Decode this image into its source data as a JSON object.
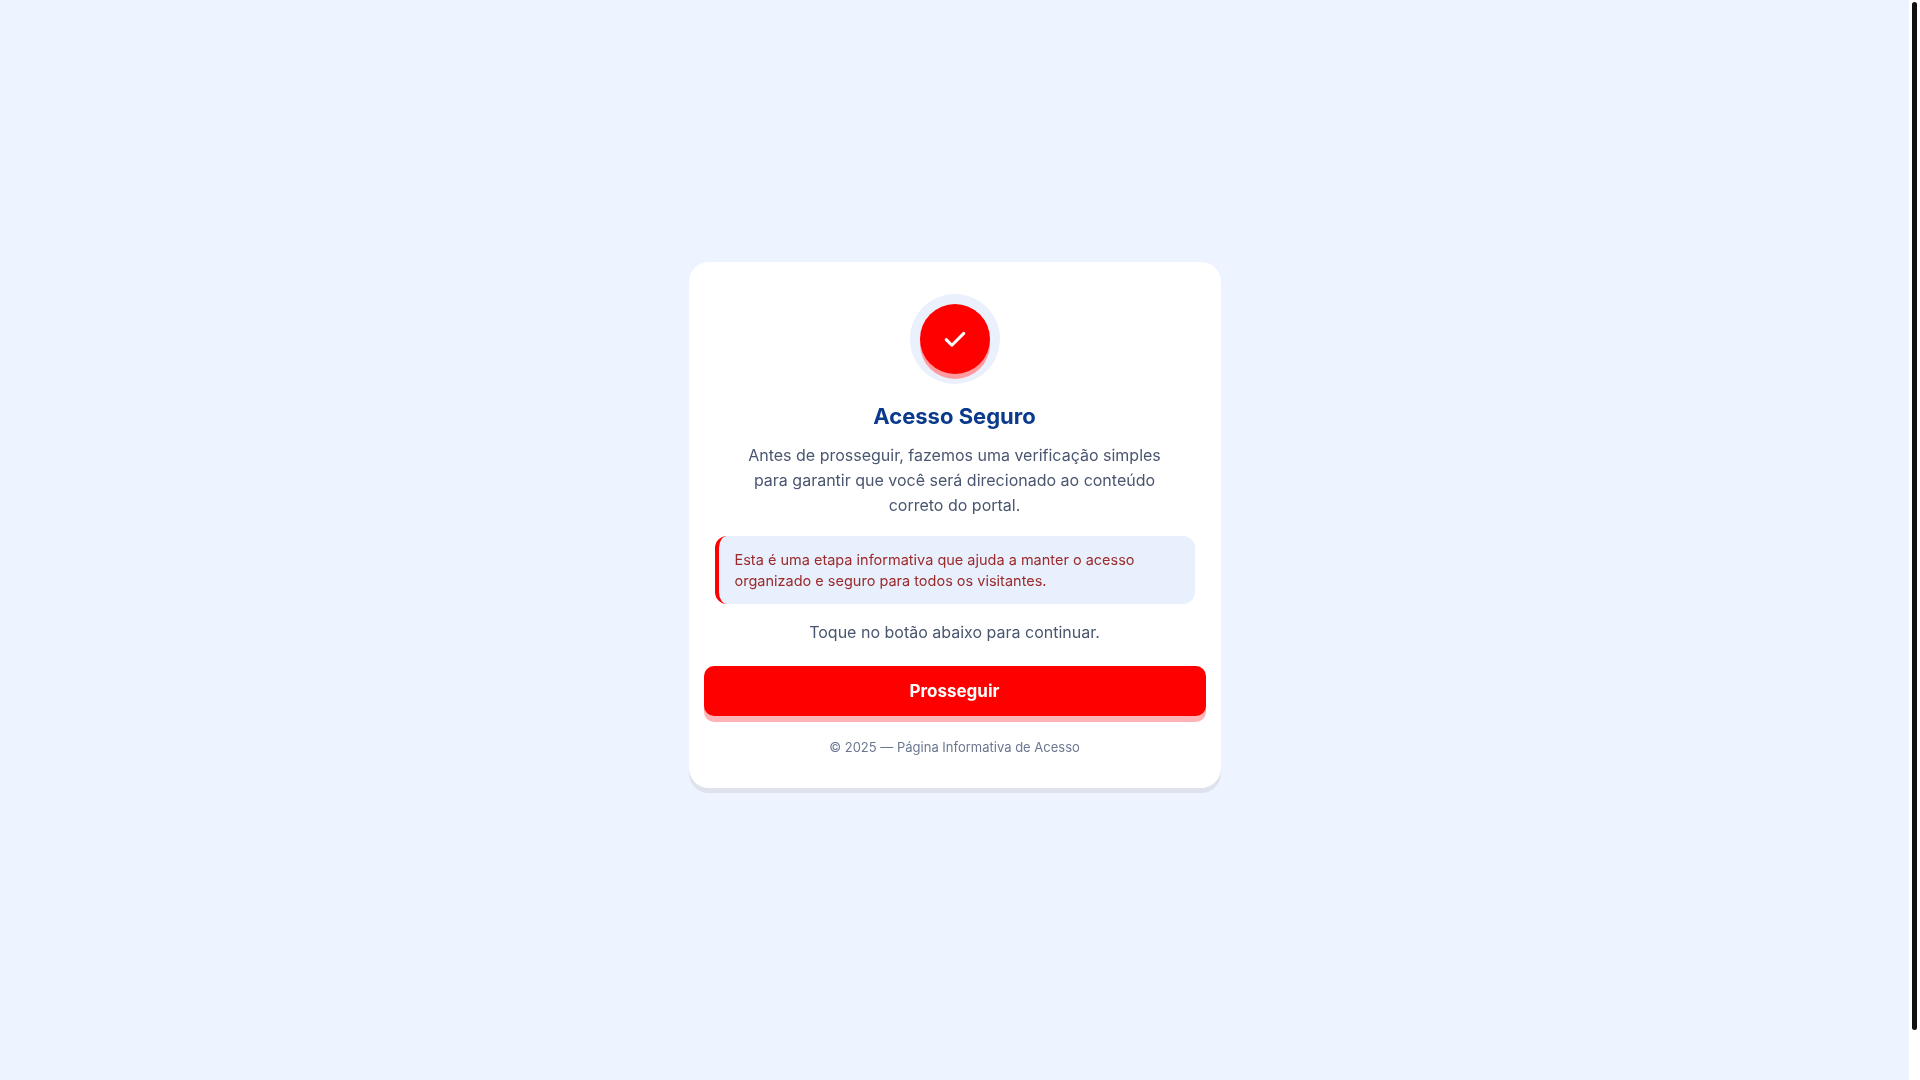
{
  "card": {
    "title": "Acesso Seguro",
    "intro": "Antes de prosseguir, fazemos uma verificação simples para garantir que você será direcionado ao conteúdo correto do portal.",
    "notice": "Esta é uma etapa informativa que ajuda a manter o acesso organizado e seguro para todos os visitantes.",
    "instruction": "Toque no botão abaixo para continuar.",
    "button": "Prosseguir",
    "footer": "© 2025 — Página Informativa de Acesso"
  }
}
